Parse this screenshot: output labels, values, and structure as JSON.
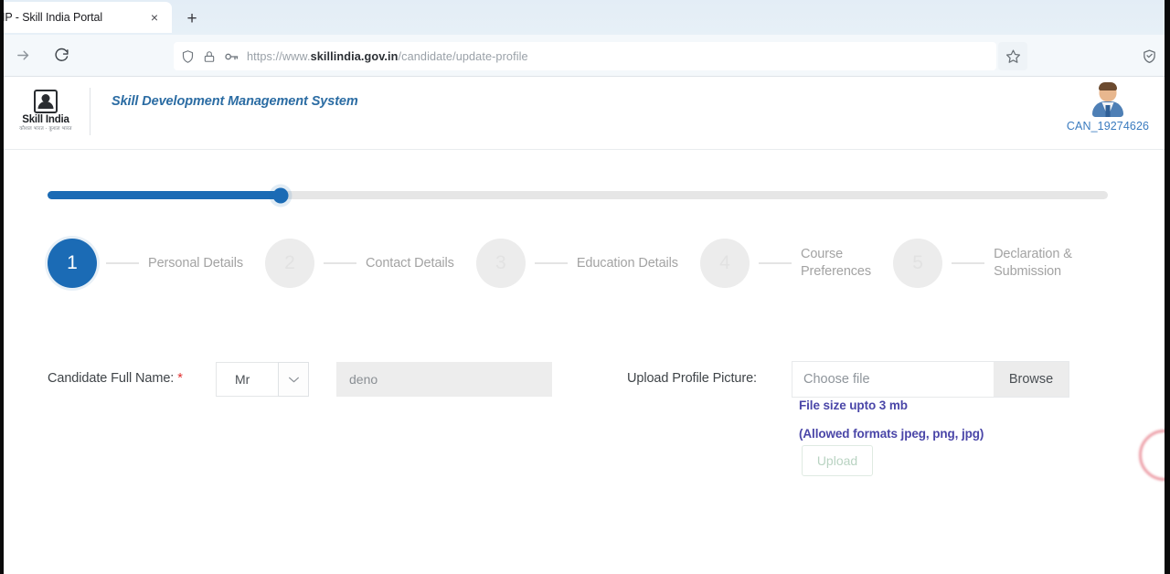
{
  "browser": {
    "tab": {
      "title": "IP - Skill India Portal",
      "close_label": "×"
    },
    "new_tab_label": "+",
    "nav": {
      "forward_icon": "forward-arrow-icon",
      "reload_icon": "reload-icon"
    },
    "url": {
      "scheme": "https://www.",
      "domain": "skillindia.gov.in",
      "path": "/candidate/update-profile",
      "shield_icon": "shield-icon",
      "lock_icon": "padlock-icon",
      "key_icon": "key-icon"
    },
    "bookmark_icon": "star-icon",
    "pocket_icon": "shield-badge-icon"
  },
  "header": {
    "logo": {
      "name": "Skill India",
      "subtitle": "कौशल भारत - कुशल भारत"
    },
    "portal_title_line1": "Skill Development Management",
    "portal_title_line2": "System",
    "user": {
      "id": "CAN_19274626",
      "avatar_icon": "user-avatar-icon"
    }
  },
  "progress": {
    "percent": 22,
    "fill_color": "#1b6bb5",
    "track_color": "#e6e6e6"
  },
  "stepper": {
    "steps": [
      {
        "number": "1",
        "label": "Personal Details",
        "state": "active"
      },
      {
        "number": "2",
        "label": "Contact Details",
        "state": "todo"
      },
      {
        "number": "3",
        "label": "Education Details",
        "state": "todo"
      },
      {
        "number": "4",
        "label": "Course\nPreferences",
        "state": "todo"
      },
      {
        "number": "5",
        "label": "Declaration &\nSubmission",
        "state": "todo"
      }
    ]
  },
  "form": {
    "name_field": {
      "label": "Candidate Full Name:",
      "required_marker": "*",
      "salutation_value": "Mr",
      "salutation_caret_icon": "chevron-down-icon",
      "name_value": "deno"
    },
    "upload_field": {
      "label": "Upload Profile Picture:",
      "file_placeholder": "Choose file",
      "browse_label": "Browse",
      "hint_size": "File size upto 3 mb",
      "hint_formats": "(Allowed formats jpeg, png, jpg)",
      "upload_label": "Upload"
    }
  }
}
